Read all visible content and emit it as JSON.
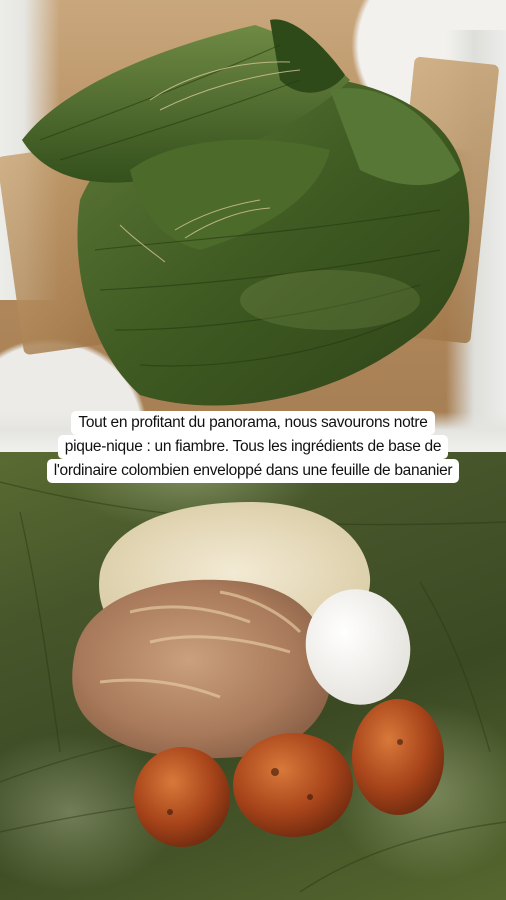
{
  "caption": {
    "lines": [
      "Tout en profitant du panorama, nous savourons notre",
      "pique-nique : un fiambre. Tous les ingrédients de base de",
      "l'ordinaire colombien enveloppé dans une feuille de bananier"
    ]
  },
  "colors": {
    "banana_leaf": "#3f5a22",
    "kraft_paper": "#b68e62",
    "plastic_bag": "#f0f0ee",
    "rice": "#efe6cf",
    "meat": "#b58a6a",
    "egg": "#fafafa",
    "plantain": "#a8441a",
    "caption_bg": "#ffffff",
    "caption_text": "#111111"
  }
}
